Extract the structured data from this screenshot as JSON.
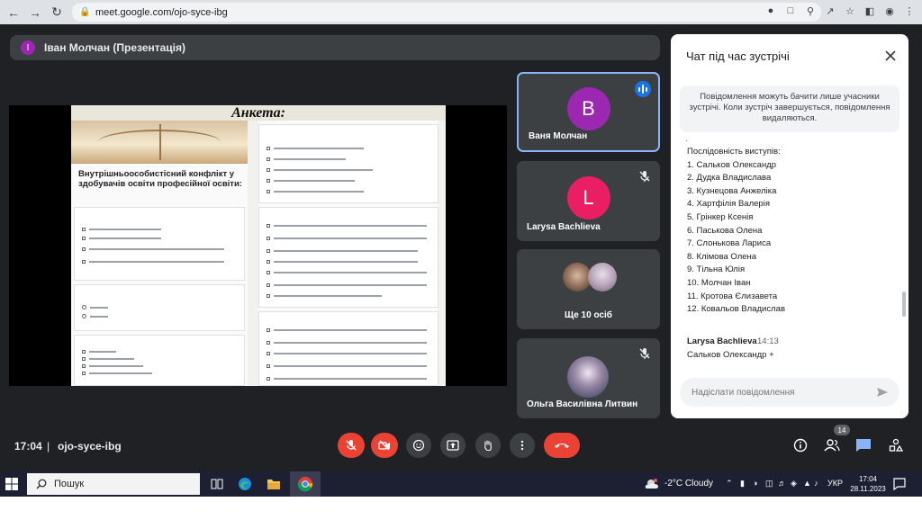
{
  "browser": {
    "url": "meet.google.com/ojo-syce-ibg"
  },
  "presentation": {
    "avatar_letter": "І",
    "title": "Іван Молчан (Презентація)",
    "slide_title": "Анкета:",
    "form_heading": "Внутрішньоособистісний конфлікт у здобувачів освіти професійної освіти:"
  },
  "tiles": [
    {
      "name": "Ваня Молчан",
      "avatar_letter": "В",
      "avatar_color": "#9c27b0"
    },
    {
      "name": "Larysa Bachlieva",
      "avatar_letter": "L",
      "avatar_color": "#e91e63"
    },
    {
      "name": "Ще 10 осіб"
    },
    {
      "name": "Ольга Василівна Литвин"
    }
  ],
  "chat": {
    "title": "Чат під час зустрічі",
    "notice": "Повідомлення можуть бачити лише учасники зустрічі. Коли зустріч завершується, повідомлення видаляються.",
    "lines": [
      "Послідовність виступів:",
      "1. Сальков Олександр",
      "2. Дудка Владислава",
      "3. Кузнецова Анжеліка",
      "4. Хартфілія Валерія",
      "5. Грінкер Ксенія",
      "6. Паськова Олена",
      "7. Слонькова Лариса",
      "8. Клімова Олена",
      "9. Тільна Юлія",
      "10. Молчан Іван",
      "11. Кротова Єлизавета",
      "12. Ковальов Владислав"
    ],
    "last_sender": "Larysa Bachlieva",
    "last_time": "14:13",
    "last_message": "Сальков Олександр +",
    "input_placeholder": "Надіслати повідомлення"
  },
  "controls": {
    "time": "17:04",
    "separator": "|",
    "meeting_code": "ojo-syce-ibg",
    "participants_badge": "14"
  },
  "taskbar": {
    "search_label": "Пошук",
    "weather": "-2°C Cloudy",
    "language": "УКР",
    "time": "17:04",
    "date": "28.11.2023"
  }
}
